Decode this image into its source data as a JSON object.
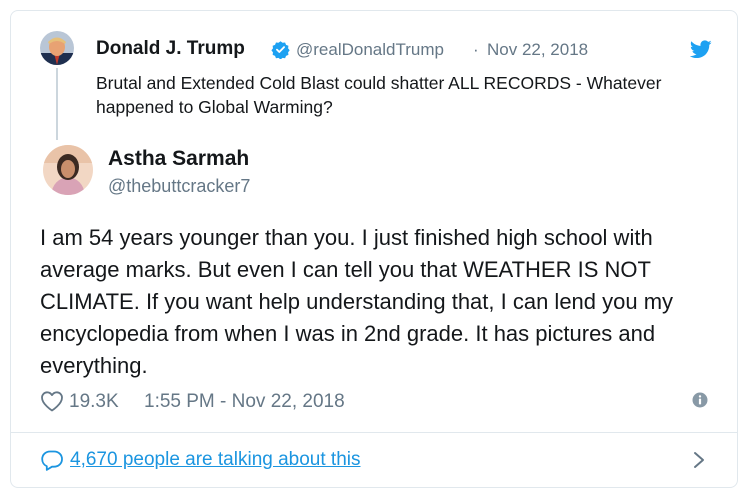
{
  "quoted_tweet": {
    "author_name": "Donald J. Trump",
    "author_handle": "@realDonaldTrump",
    "separator": "·",
    "date": "Nov 22, 2018",
    "text": "Brutal and Extended Cold Blast could shatter ALL RECORDS - Whatever happened to Global Warming?",
    "verified_icon": "verified-badge-icon"
  },
  "reply_tweet": {
    "author_name": "Astha Sarmah",
    "author_handle": "@thebuttcracker7",
    "text": "I am 54 years younger than you. I just finished high school with average marks. But even I can tell you that  WEATHER IS NOT CLIMATE. If you want help understanding that, I can lend you my encyclopedia from when I was in 2nd grade. It has pictures and everything.",
    "likes": "19.3K",
    "timestamp": "1:55 PM - Nov 22, 2018"
  },
  "footer": {
    "talking_text": "4,670 people are talking about this"
  },
  "icons": {
    "brand": "twitter-bird-icon",
    "like": "heart-icon",
    "info": "info-icon",
    "reply": "speech-bubble-icon",
    "chevron": "chevron-right-icon"
  },
  "colors": {
    "accent": "#1b95e0",
    "verified": "#1da1f2",
    "muted": "#657786",
    "text": "#14171a",
    "border": "#e1e8ed"
  }
}
